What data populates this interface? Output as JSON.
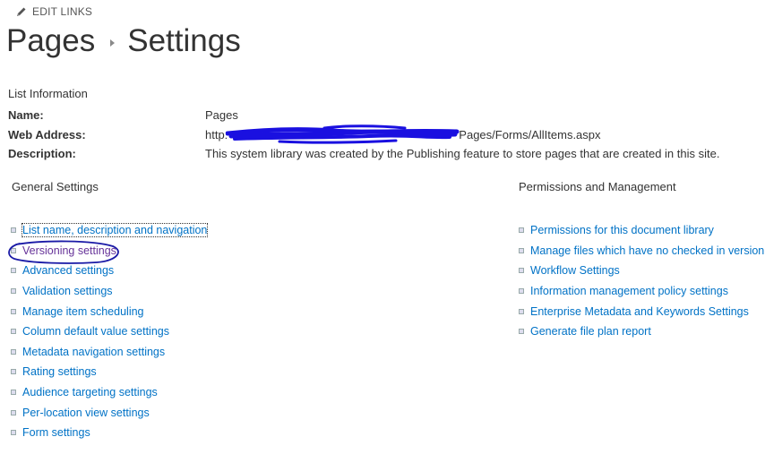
{
  "edit_links": {
    "label": "EDIT LINKS",
    "icon": "pencil-icon"
  },
  "breadcrumb": {
    "first": "Pages",
    "second": "Settings"
  },
  "list_info": {
    "heading": "List Information",
    "name_label": "Name:",
    "name_value": "Pages",
    "web_label": "Web Address:",
    "web_prefix": "http:",
    "web_suffix": "Pages/Forms/AllItems.aspx",
    "desc_label": "Description:",
    "desc_value": "This system library was created by the Publishing feature to store pages that are created in this site."
  },
  "general_settings": {
    "heading": "General Settings",
    "items": [
      {
        "label": "List name, description and navigation"
      },
      {
        "label": "Versioning settings"
      },
      {
        "label": "Advanced settings"
      },
      {
        "label": "Validation settings"
      },
      {
        "label": "Manage item scheduling"
      },
      {
        "label": "Column default value settings"
      },
      {
        "label": "Metadata navigation settings"
      },
      {
        "label": "Rating settings"
      },
      {
        "label": "Audience targeting settings"
      },
      {
        "label": "Per-location view settings"
      },
      {
        "label": "Form settings"
      }
    ]
  },
  "permissions_management": {
    "heading": "Permissions and Management",
    "items": [
      {
        "label": "Permissions for this document library"
      },
      {
        "label": "Manage files which have no checked in version"
      },
      {
        "label": "Workflow Settings"
      },
      {
        "label": "Information management policy settings"
      },
      {
        "label": "Enterprise Metadata and Keywords Settings"
      },
      {
        "label": "Generate file plan report"
      }
    ]
  },
  "colors": {
    "link": "#0072c6",
    "visited_link": "#663399",
    "annotation": "#1a1aa6",
    "redaction": "#1a10e0"
  }
}
